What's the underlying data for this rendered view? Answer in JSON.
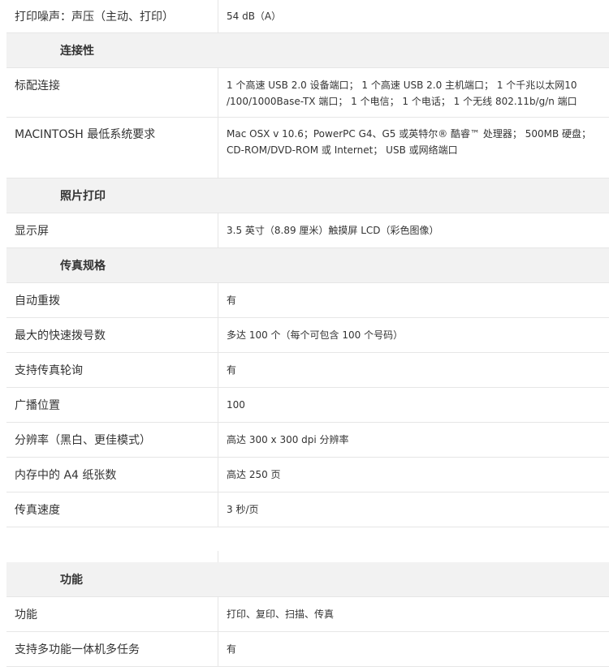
{
  "rows_top": [
    {
      "label": "打印噪声：声压（主动、打印）",
      "value": "54 dB（A）"
    }
  ],
  "sections": {
    "connectivity": "连接性",
    "photo": "照片打印",
    "fax": "传真规格",
    "features": "功能"
  },
  "connectivity": [
    {
      "label": "标配连接",
      "value": "1 个高速 USB 2.0 设备端口； 1 个高速 USB 2.0 主机端口； 1 个千兆以太网10 /100/1000Base-TX 端口； 1 个电信； 1 个电话； 1 个无线 802.11b/g/n 端口"
    },
    {
      "label": "MACINTOSH 最低系统要求",
      "value": "Mac OSX v 10.6；PowerPC G4、G5 或英特尔® 酷睿™ 处理器； 500MB 硬盘； CD-ROM/DVD-ROM 或 Internet； USB 或网络端口"
    }
  ],
  "photo": [
    {
      "label": "显示屏",
      "value": "3.5 英寸（8.89 厘米）触摸屏 LCD（彩色图像）"
    }
  ],
  "fax": [
    {
      "label": "自动重拨",
      "value": "有"
    },
    {
      "label": "最大的快速拨号数",
      "value": "多达 100 个（每个可包含 100 个号码）"
    },
    {
      "label": "支持传真轮询",
      "value": "有"
    },
    {
      "label": "广播位置",
      "value": "100"
    },
    {
      "label": "分辨率（黑白、更佳模式）",
      "value": "高达 300 x 300 dpi 分辨率"
    },
    {
      "label": "内存中的 A4 纸张数",
      "value": "高达 250 页"
    },
    {
      "label": "传真速度",
      "value": "3 秒/页"
    }
  ],
  "features": [
    {
      "label": "功能",
      "value": "打印、复印、扫描、传真"
    },
    {
      "label": "支持多功能一体机多任务",
      "value": "有"
    }
  ]
}
